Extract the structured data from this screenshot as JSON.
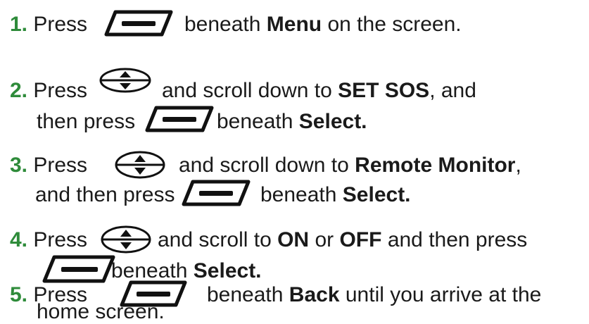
{
  "steps": [
    {
      "number": "1.",
      "lines": [
        {
          "parts": [
            "Press",
            "beneath",
            "Menu",
            "on the screen."
          ]
        }
      ],
      "icons": [
        "softkey-icon"
      ]
    },
    {
      "number": "2.",
      "lines": [
        {
          "parts": [
            "Press",
            "and scroll down to",
            "SET SOS",
            ", and"
          ]
        },
        {
          "parts": [
            "then press",
            "beneath",
            "Select."
          ]
        }
      ],
      "icons": [
        "scroll-key-icon",
        "softkey-icon"
      ]
    },
    {
      "number": "3.",
      "lines": [
        {
          "parts": [
            "Press",
            "and scroll down to",
            "Remote Monitor",
            ","
          ]
        },
        {
          "parts": [
            "and then press",
            "beneath",
            "Select."
          ]
        }
      ],
      "icons": [
        "scroll-key-icon",
        "softkey-icon"
      ]
    },
    {
      "number": "4.",
      "lines": [
        {
          "parts": [
            "Press",
            "and scroll to",
            "ON",
            "or",
            "OFF",
            "and then press"
          ]
        },
        {
          "parts": [
            "beneath",
            "Select."
          ]
        }
      ],
      "icons": [
        "scroll-key-icon",
        "softkey-icon"
      ]
    },
    {
      "number": "5.",
      "lines": [
        {
          "parts": [
            "Press",
            "beneath",
            "Back",
            "until you arrive at the"
          ]
        },
        {
          "parts": [
            "home screen."
          ]
        }
      ],
      "icons": [
        "softkey-icon"
      ]
    }
  ],
  "colors": {
    "step_number": "#2e8b3a",
    "text": "#1a1a1a",
    "icon": "#111111"
  }
}
